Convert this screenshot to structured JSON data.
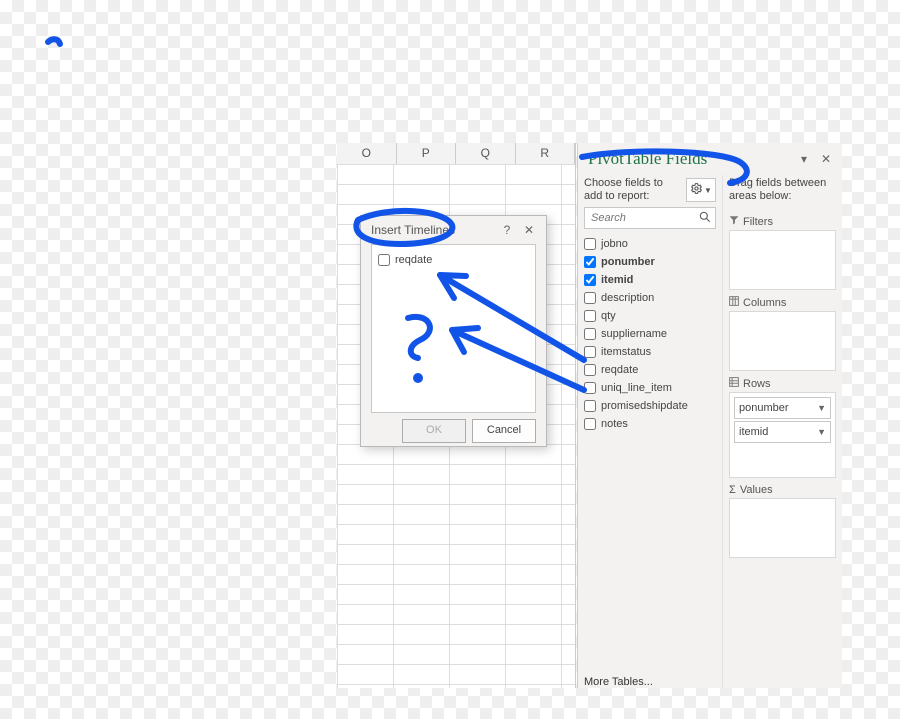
{
  "columns": [
    "O",
    "P",
    "Q",
    "R"
  ],
  "pane": {
    "title": "PivotTable Fields",
    "choose_label": "Choose fields to add to report:",
    "search_placeholder": "Search",
    "drag_label": "Drag fields between areas below:",
    "more_tables": "More Tables...",
    "sections": {
      "filters": "Filters",
      "columns": "Columns",
      "rows": "Rows",
      "values": "Values"
    }
  },
  "fields": [
    {
      "name": "jobno",
      "checked": false
    },
    {
      "name": "ponumber",
      "checked": true
    },
    {
      "name": "itemid",
      "checked": true
    },
    {
      "name": "description",
      "checked": false
    },
    {
      "name": "qty",
      "checked": false
    },
    {
      "name": "suppliername",
      "checked": false
    },
    {
      "name": "itemstatus",
      "checked": false
    },
    {
      "name": "reqdate",
      "checked": false
    },
    {
      "name": "uniq_line_item",
      "checked": false
    },
    {
      "name": "promisedshipdate",
      "checked": false
    },
    {
      "name": "notes",
      "checked": false
    }
  ],
  "rows_area": [
    "ponumber",
    "itemid"
  ],
  "dialog": {
    "title": "Insert Timelines",
    "field": "reqdate",
    "ok": "OK",
    "cancel": "Cancel"
  }
}
